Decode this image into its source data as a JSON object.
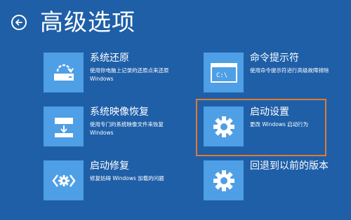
{
  "header": {
    "title": "高级选项",
    "back_icon": "back-arrow-icon"
  },
  "options": [
    {
      "id": "system-restore",
      "label": "系统还原",
      "line1": "使用你电脑上记录的还原点来还原",
      "line2": "Windows",
      "icon": "restore-icon"
    },
    {
      "id": "command-prompt",
      "label": "命令提示符",
      "line1": "使用命令提示符进行高级故障排除",
      "line2": "",
      "icon": "command-prompt-icon"
    },
    {
      "id": "system-image-recovery",
      "label": "系统映像恢复",
      "line1": "使用专门的系统映像文件来恢复",
      "line2": "Windows",
      "icon": "image-recovery-icon"
    },
    {
      "id": "startup-settings",
      "label": "启动设置",
      "line1": "更改 Windows 启动行为",
      "line2": "",
      "icon": "gear-icon",
      "highlighted": true
    },
    {
      "id": "startup-repair",
      "label": "启动修复",
      "line1": "修复妨碍 Windows 加载的问题",
      "line2": "",
      "icon": "startup-repair-icon"
    },
    {
      "id": "go-back",
      "label": "回退到以前的版本",
      "line1": "",
      "line2": "",
      "icon": "gear-icon"
    }
  ],
  "colors": {
    "background": "#1e5fa8",
    "tile": "#4e9fe5",
    "highlight_border": "#e07a2e"
  }
}
